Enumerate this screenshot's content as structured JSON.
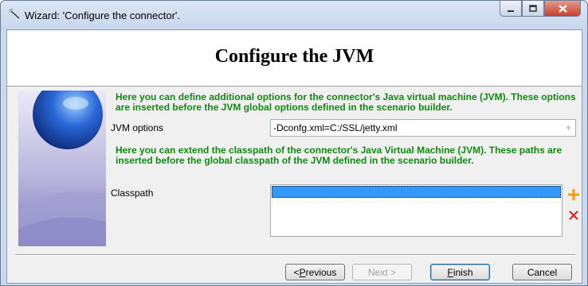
{
  "window": {
    "title": "Wizard: 'Configure the connector'."
  },
  "header": {
    "title": "Configure the JVM"
  },
  "jvm_section": {
    "description": "Here you can define additional options for the connector's Java virtual machine (JVM). These options are inserted before the JVM global options defined in the scenario builder.",
    "label": "JVM options",
    "value": "-Dconfg.xml=C:/SSL/jetty.xml"
  },
  "classpath_section": {
    "description": "Here you can extend the classpath of the connector's Java Virtual Machine (JVM). These paths are inserted before the global classpath of the JVM defined in the scenario builder.",
    "label": "Classpath",
    "items": [
      ""
    ]
  },
  "buttons": {
    "previous": {
      "prefix": "< ",
      "mnemonic": "P",
      "rest": "revious"
    },
    "next": "Next >",
    "finish": {
      "mnemonic": "F",
      "rest": "inish"
    },
    "cancel": "Cancel"
  },
  "colors": {
    "accent_text": "#118811",
    "selection": "#3399ff",
    "add_icon": "#f5a000",
    "remove_icon": "#d42020"
  }
}
